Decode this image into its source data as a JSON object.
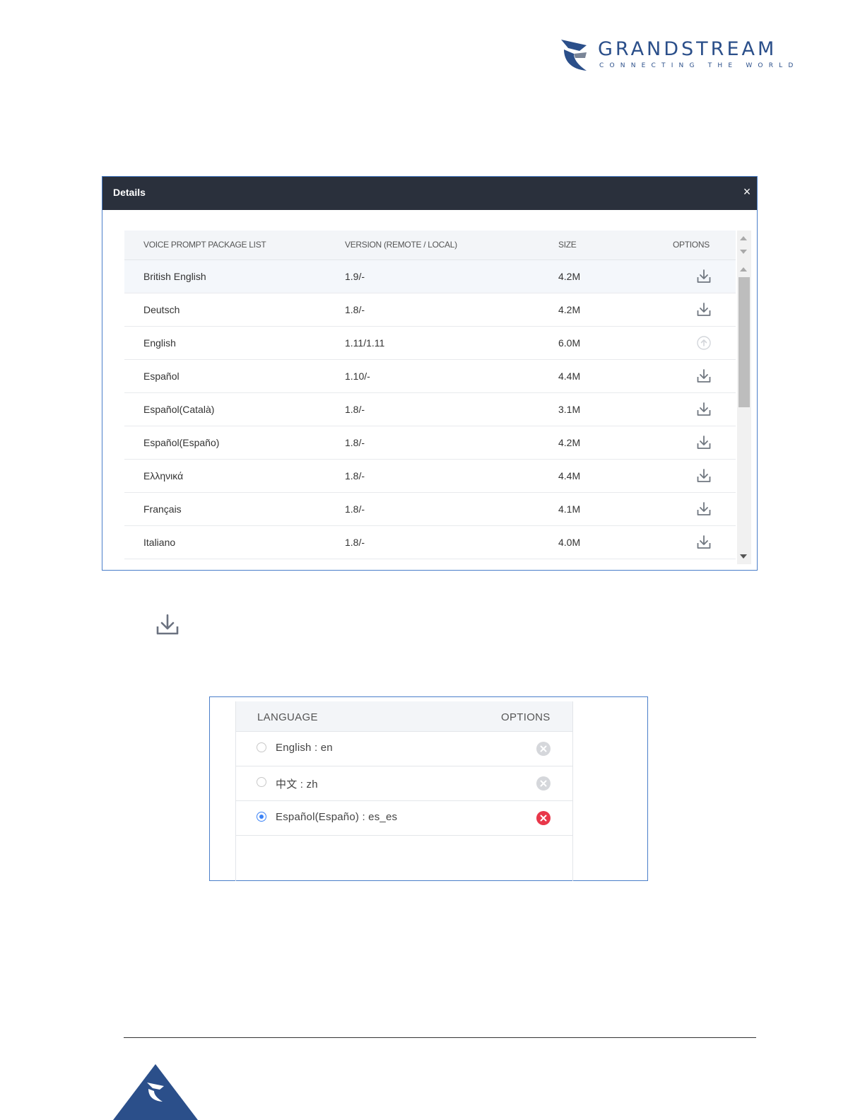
{
  "brand": {
    "name": "GRANDSTREAM",
    "tagline": "CONNECTING THE WORLD",
    "color": "#2b4f8a"
  },
  "dialog": {
    "title": "Details",
    "close_symbol": "×",
    "columns": [
      "VOICE PROMPT PACKAGE LIST",
      "VERSION (REMOTE / LOCAL)",
      "SIZE",
      "OPTIONS"
    ],
    "rows": [
      {
        "name": "British English",
        "version": "1.9/-",
        "size": "4.2M",
        "option": "download-icon"
      },
      {
        "name": "Deutsch",
        "version": "1.8/-",
        "size": "4.2M",
        "option": "download-icon"
      },
      {
        "name": "English",
        "version": "1.11/1.11",
        "size": "6.0M",
        "option": "upgrade-icon"
      },
      {
        "name": "Español",
        "version": "1.10/-",
        "size": "4.4M",
        "option": "download-icon"
      },
      {
        "name": "Español(Català)",
        "version": "1.8/-",
        "size": "3.1M",
        "option": "download-icon"
      },
      {
        "name": "Español(Españo)",
        "version": "1.8/-",
        "size": "4.2M",
        "option": "download-icon"
      },
      {
        "name": "Ελληνικά",
        "version": "1.8/-",
        "size": "4.4M",
        "option": "download-icon"
      },
      {
        "name": "Français",
        "version": "1.8/-",
        "size": "4.1M",
        "option": "download-icon"
      },
      {
        "name": "Italiano",
        "version": "1.8/-",
        "size": "4.0M",
        "option": "download-icon"
      }
    ]
  },
  "language_panel": {
    "columns": [
      "LANGUAGE",
      "OPTIONS"
    ],
    "rows": [
      {
        "label": "English : en",
        "selected": false,
        "option": "remove-icon-disabled"
      },
      {
        "label": "中文 : zh",
        "selected": false,
        "option": "remove-icon-disabled"
      },
      {
        "label": "Español(Españo) : es_es",
        "selected": true,
        "option": "remove-icon-active"
      }
    ],
    "accent_color": "#3b82f6",
    "remove_color": "#e8374a"
  }
}
